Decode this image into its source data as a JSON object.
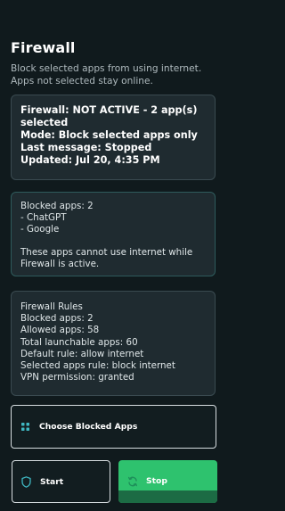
{
  "header": {
    "title": "Firewall",
    "subtitle": "Block selected apps from using internet. Apps not selected stay online."
  },
  "status": {
    "lines": [
      "Firewall: NOT ACTIVE - 2 app(s)",
      "selected",
      "Mode: Block selected apps only",
      "Last message: Stopped",
      "Updated: Jul 20, 4:35 PM"
    ]
  },
  "blocked": {
    "count_line": "Blocked apps: 2",
    "apps": [
      "- ChatGPT",
      "- Google"
    ],
    "note_lines": [
      "These apps cannot use internet while",
      "Firewall is active."
    ]
  },
  "rules": {
    "lines": [
      "Firewall Rules",
      "Blocked apps: 2",
      "Allowed apps: 58",
      "Total launchable apps: 60",
      "Default rule: allow internet",
      "Selected apps rule: block internet",
      "VPN permission: granted"
    ]
  },
  "actions": {
    "choose_label": "Choose Blocked Apps",
    "choose_icon": "grid-icon",
    "start_label": "Start",
    "start_icon": "shield-icon",
    "stop_label": "Stop",
    "stop_icon": "refresh-icon"
  },
  "colors": {
    "background": "#101a1d",
    "card": "#1f2b30",
    "accent_green": "#2ec26e",
    "accent_teal": "#3fb7c2"
  }
}
